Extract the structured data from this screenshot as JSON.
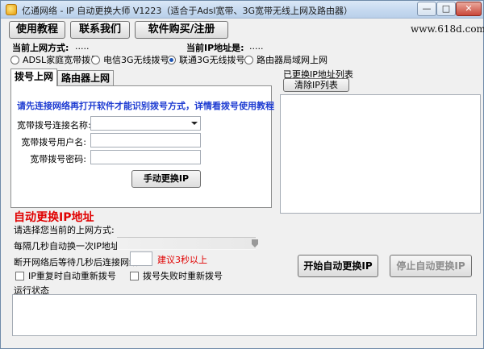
{
  "window": {
    "title": "亿通网络 - IP 自动更换大师 V1223（适合于Adsl宽带、3G宽带无线上网及路由器）",
    "min_label": "—",
    "max_label": "□",
    "close_label": "✕"
  },
  "toolbar": {
    "tutorial": "使用教程",
    "contact": "联系我们",
    "purchase": "软件购买/注册"
  },
  "site_url": "www.618d.com",
  "current_mode_label": "当前上网方式:",
  "current_mode_value": ".....",
  "current_ip_label": "当前IP地址是:",
  "current_ip_value": ".....",
  "modes": [
    {
      "label": "ADSL家庭宽带拨号",
      "checked": false
    },
    {
      "label": "电信3G无线拨号",
      "checked": false
    },
    {
      "label": "联通3G无线拨号",
      "checked": true
    },
    {
      "label": "路由器局域网上网",
      "checked": false
    }
  ],
  "tabs": [
    {
      "label": "拨号上网",
      "active": true
    },
    {
      "label": "路由器上网",
      "active": false
    }
  ],
  "dial": {
    "notice": "请先连接网络再打开软件才能识别拨号方式，详情看拨号使用教程",
    "conn_name_label": "宽带拨号连接名称:",
    "conn_name_value": "",
    "user_label": "宽带拨号用户名:",
    "user_value": "",
    "pass_label": "宽带拨号密码:",
    "pass_value": "",
    "manual_button": "手动更换IP"
  },
  "iplist": {
    "title": "已更换IP地址列表",
    "clear_button": "清除IP列表",
    "items": []
  },
  "auto": {
    "title": "自动更换IP地址",
    "mode_prompt": "请选择您当前的上网方式:",
    "interval_label": "每隔几秒自动换一次IP地址:",
    "wait_label": "断开网络后等待几秒后连接网络:",
    "wait_value": "",
    "wait_hint": "建议3秒以上",
    "redial_on_repeat": "IP重复时自动重新拨号",
    "redial_on_fail": "拨号失败时重新拨号",
    "start_button": "开始自动更换IP",
    "stop_button": "停止自动更换IP"
  },
  "status": {
    "label": "运行状态",
    "text": ""
  },
  "colors": {
    "notice_blue": "#1e3cd2",
    "title_red": "#e00000"
  }
}
